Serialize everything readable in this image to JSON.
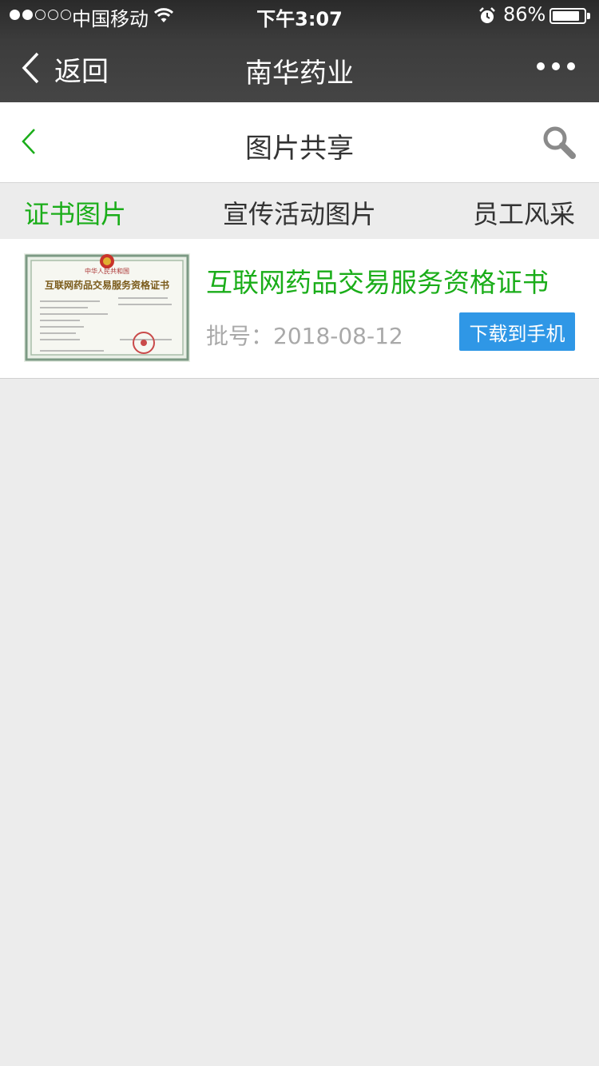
{
  "status_bar": {
    "carrier": "中国移动",
    "time": "下午3:07",
    "battery_percent": "86%",
    "battery_level": 0.86,
    "signal_bars_filled": 2,
    "signal_bars_total": 5,
    "icons": [
      "wifi-icon",
      "alarm-icon",
      "battery-icon"
    ]
  },
  "nav": {
    "back_label": "返回",
    "title": "南华药业",
    "icons": [
      "chevron-left-icon",
      "more-icon"
    ]
  },
  "page": {
    "title": "图片共享",
    "icons": [
      "chevron-left-icon",
      "search-icon"
    ]
  },
  "tabs": [
    {
      "label": "证书图片",
      "active": true
    },
    {
      "label": "宣传活动图片",
      "active": false
    },
    {
      "label": "员工风采",
      "active": false
    }
  ],
  "items": [
    {
      "title": "互联网药品交易服务资格证书",
      "meta": "批号：2018-08-12",
      "button_label": "下载到手机",
      "thumbnail": {
        "header": "中华人民共和国",
        "title": "互联网药品交易服务资格证书"
      }
    }
  ],
  "colors": {
    "accent_green": "#1aad19",
    "button_blue": "#2f97e6",
    "background": "#ececec",
    "nav_dark": "#3c3c3c"
  }
}
